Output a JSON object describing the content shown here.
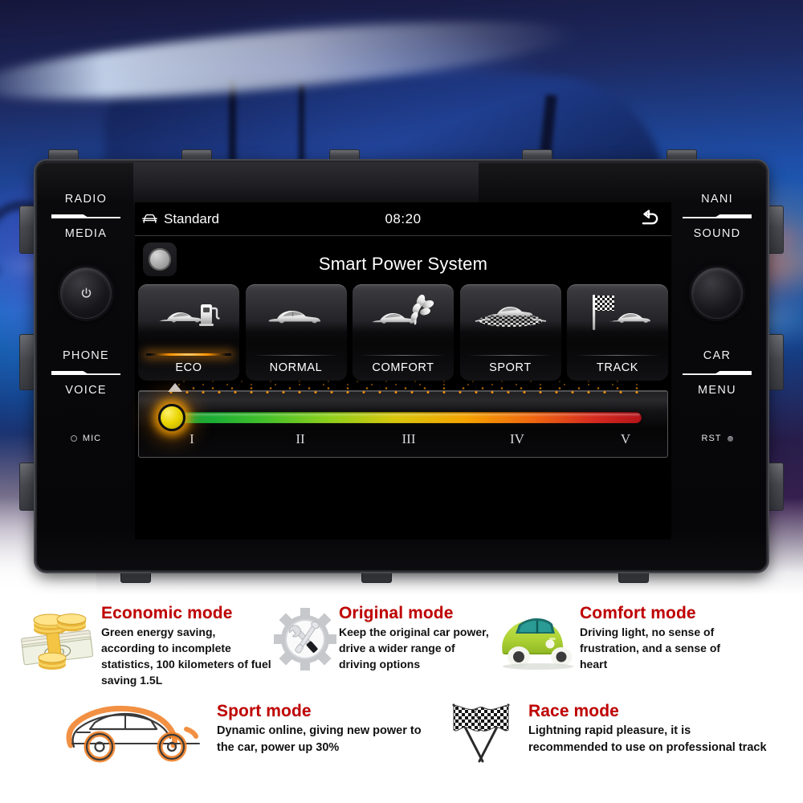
{
  "head_unit": {
    "left_keys": [
      {
        "label": "RADIO",
        "name": "radio-key"
      },
      {
        "label": "MEDIA",
        "name": "media-key"
      },
      {
        "label": "PHONE",
        "name": "phone-key"
      },
      {
        "label": "VOICE",
        "name": "voice-key"
      }
    ],
    "right_keys": [
      {
        "label": "NANI",
        "name": "nani-key"
      },
      {
        "label": "SOUND",
        "name": "sound-key"
      },
      {
        "label": "CAR",
        "name": "car-key"
      },
      {
        "label": "MENU",
        "name": "menu-key"
      }
    ],
    "mic_label": "MIC",
    "reset_label": "RST",
    "power_icon": "power-icon",
    "volume_knob_icon": "rotary-knob"
  },
  "screen": {
    "statusbar": {
      "car_icon": "car-front-icon",
      "profile": "Standard",
      "clock": "08:20",
      "back_icon": "back-arrow-icon"
    },
    "title": "Smart Power System",
    "hard_button_icon": "home-button-icon",
    "modes": [
      {
        "label": "ECO",
        "icon": "car-fuel-pump-icon",
        "active": true
      },
      {
        "label": "NORMAL",
        "icon": "car-icon",
        "active": false
      },
      {
        "label": "COMFORT",
        "icon": "car-leaf-icon",
        "active": false
      },
      {
        "label": "SPORT",
        "icon": "car-checkered-icon",
        "active": false
      },
      {
        "label": "TRACK",
        "icon": "car-race-flag-icon",
        "active": false
      }
    ],
    "slider": {
      "ticks": [
        "I",
        "II",
        "III",
        "IV",
        "V"
      ],
      "value": "I",
      "value_index": 0,
      "gradient_start": "#00a13c",
      "gradient_end": "#b4141a",
      "thumb_color": "#e8d400",
      "thumb_glow": "#ffa500"
    }
  },
  "info_cards": {
    "row1": [
      {
        "title": "Economic mode",
        "desc": "Green energy saving, according to incomplete statistics, 100 kilometers of fuel saving 1.5L",
        "art": "money-stack-icon"
      },
      {
        "title": "Original  mode",
        "desc": "Keep the original car power, drive a wider range of driving options",
        "art": "gear-tools-icon"
      },
      {
        "title": "Comfort mode",
        "desc": "Driving light, no sense of frustration, and a sense of heart",
        "art": "green-car-icon"
      }
    ],
    "row2": [
      {
        "title": "Sport mode",
        "desc": "Dynamic online, giving new power to the car, power up 30%",
        "art": "orange-sportscar-sketch-icon"
      },
      {
        "title": "Race mode",
        "desc": "Lightning rapid pleasure, it is recommended to use on professional track",
        "art": "crossed-checkered-flags-icon"
      }
    ]
  },
  "colors": {
    "title_red": "#c00000",
    "accent_orange": "#ff9400",
    "screen_bg": "#000000"
  }
}
